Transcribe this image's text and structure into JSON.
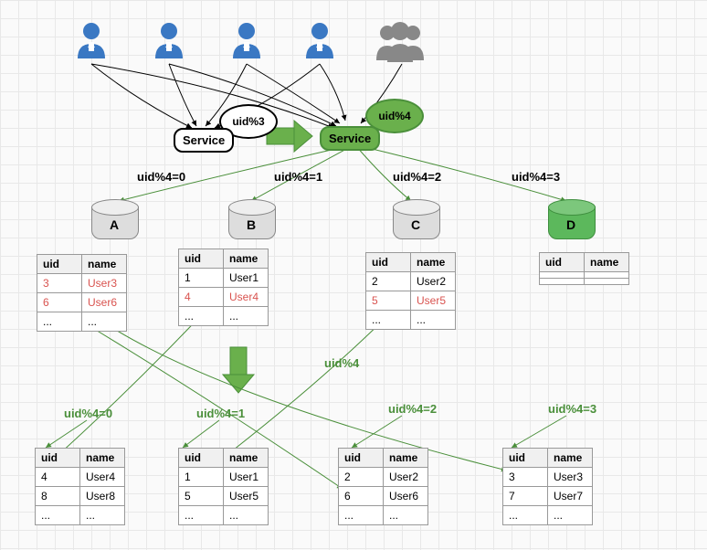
{
  "top": {
    "service_left": "Service",
    "service_right": "Service",
    "bubble_left": "uid%3",
    "bubble_right": "uid%4"
  },
  "shard_labels": {
    "s0": "uid%4=0",
    "s1": "uid%4=1",
    "s2": "uid%4=2",
    "s3": "uid%4=3"
  },
  "arrow_middle_label": "uid%4",
  "reshard_labels": {
    "r0": "uid%4=0",
    "r1": "uid%4=1",
    "r2": "uid%4=2",
    "r3": "uid%4=3"
  },
  "dbs": {
    "a": "A",
    "b": "B",
    "c": "C",
    "d": "D"
  },
  "cols": {
    "uid": "uid",
    "name": "name"
  },
  "tables_top": {
    "a": [
      {
        "uid": "3",
        "name": "User3",
        "red": true
      },
      {
        "uid": "6",
        "name": "User6",
        "red": true
      },
      {
        "uid": "...",
        "name": "..."
      }
    ],
    "b": [
      {
        "uid": "1",
        "name": "User1"
      },
      {
        "uid": "4",
        "name": "User4",
        "red": true
      },
      {
        "uid": "...",
        "name": "..."
      }
    ],
    "c": [
      {
        "uid": "2",
        "name": "User2"
      },
      {
        "uid": "5",
        "name": "User5",
        "red": true
      },
      {
        "uid": "...",
        "name": "..."
      }
    ],
    "d": [
      {
        "uid": "",
        "name": ""
      },
      {
        "uid": "",
        "name": ""
      }
    ]
  },
  "tables_bottom": {
    "a": [
      {
        "uid": "4",
        "name": "User4"
      },
      {
        "uid": "8",
        "name": "User8"
      },
      {
        "uid": "...",
        "name": "..."
      }
    ],
    "b": [
      {
        "uid": "1",
        "name": "User1"
      },
      {
        "uid": "5",
        "name": "User5"
      },
      {
        "uid": "...",
        "name": "..."
      }
    ],
    "c": [
      {
        "uid": "2",
        "name": "User2"
      },
      {
        "uid": "6",
        "name": "User6"
      },
      {
        "uid": "...",
        "name": "..."
      }
    ],
    "d": [
      {
        "uid": "3",
        "name": "User3"
      },
      {
        "uid": "7",
        "name": "User7"
      },
      {
        "uid": "...",
        "name": "..."
      }
    ]
  }
}
